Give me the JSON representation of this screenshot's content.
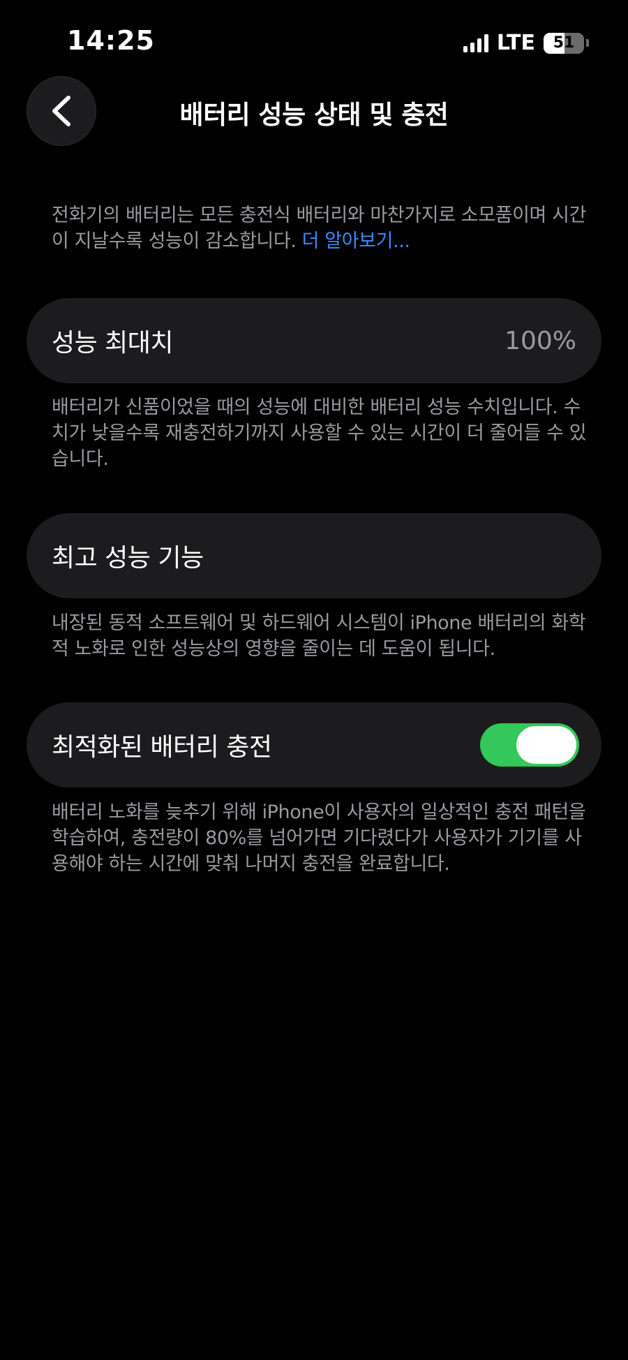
{
  "status_bar": {
    "time": "14:25",
    "network": "LTE",
    "battery_level": "51"
  },
  "nav": {
    "title": "배터리 성능 상태 및 충전",
    "back_icon": "chevron-left-icon"
  },
  "intro": {
    "text": "전화기의 배터리는 모든 충전식 배터리와 마찬가지로 소모품이며 시간이 지날수록 성능이 감소합니다. ",
    "link": "더 알아보기..."
  },
  "maximum_capacity": {
    "label": "성능 최대치",
    "value": "100%",
    "description": "배터리가 신품이었을 때의 성능에 대비한 배터리 성능 수치입니다. 수치가 낮을수록 재충전하기까지 사용할 수 있는 시간이 더 줄어들 수 있습니다."
  },
  "peak_performance": {
    "label": "최고 성능 기능",
    "description": "내장된 동적 소프트웨어 및 하드웨어 시스템이 iPhone 배터리의 화학적 노화로 인한 성능상의 영향을 줄이는 데 도움이 됩니다."
  },
  "optimized_charging": {
    "label": "최적화된 배터리 충전",
    "enabled": true,
    "description": "배터리 노화를 늦추기 위해 iPhone이 사용자의 일상적인 충전 패턴을 학습하여, 충전량이 80%를 넘어가면 기다렸다가 사용자가 기기를 사용해야 하는 시간에 맞춰 나머지 충전을 완료합니다."
  },
  "colors": {
    "background": "#000000",
    "card": "#1c1c1e",
    "secondary_text": "#9a9aa0",
    "link": "#3a8cff",
    "toggle_on": "#34c759"
  }
}
